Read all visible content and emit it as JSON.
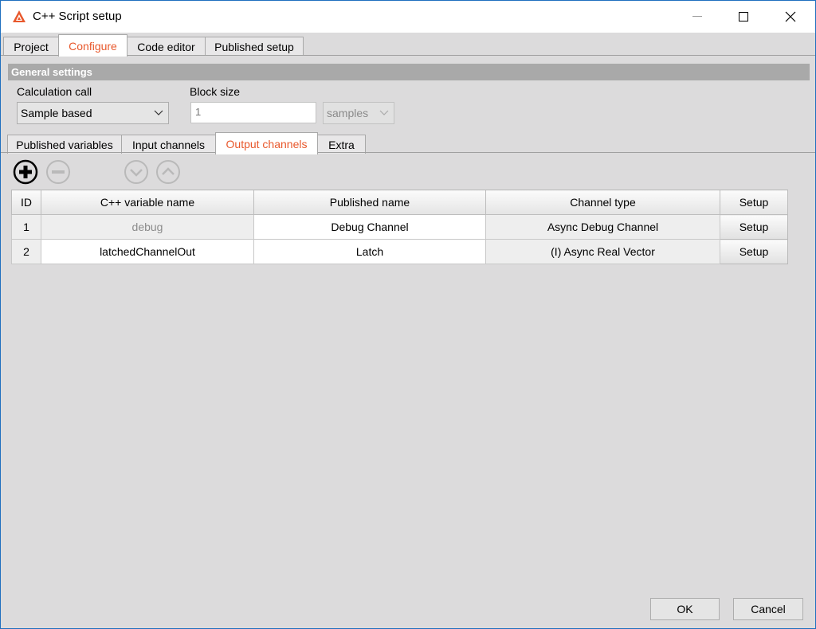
{
  "window": {
    "title": "C++ Script setup",
    "app_icon": "dewesoft-logo-icon",
    "controls": [
      "minimize-icon",
      "maximize-icon",
      "close-icon"
    ]
  },
  "main_tabs": [
    {
      "label": "Project",
      "active": false
    },
    {
      "label": "Configure",
      "active": true
    },
    {
      "label": "Code editor",
      "active": false
    },
    {
      "label": "Published setup",
      "active": false
    }
  ],
  "general_settings": {
    "header": "General settings",
    "calc_call_label": "Calculation call",
    "calc_call_value": "Sample based",
    "block_size_label": "Block size",
    "block_size_value": "1",
    "block_unit_value": "samples"
  },
  "sub_tabs": [
    {
      "label": "Published variables",
      "active": false
    },
    {
      "label": "Input channels",
      "active": false
    },
    {
      "label": "Output channels",
      "active": true
    },
    {
      "label": "Extra",
      "active": false
    }
  ],
  "toolbar": {
    "add": "add-circle-icon",
    "remove": "remove-circle-icon",
    "move_down": "move-down-circle-icon",
    "move_up": "move-up-circle-icon"
  },
  "table": {
    "headers": [
      "ID",
      "C++ variable name",
      "Published name",
      "Channel type",
      "Setup"
    ],
    "rows": [
      {
        "id": "1",
        "var": "debug",
        "published": "Debug Channel",
        "type": "Async Debug Channel",
        "setup": "Setup"
      },
      {
        "id": "2",
        "var": "latchedChannelOut",
        "published": "Latch",
        "type": "(I) Async Real Vector",
        "setup": "Setup"
      }
    ]
  },
  "footer": {
    "ok_label": "OK",
    "cancel_label": "Cancel"
  },
  "colors": {
    "accent": "#e8582c",
    "background": "#dcdbdc",
    "section_header": "#a9a9a9"
  }
}
